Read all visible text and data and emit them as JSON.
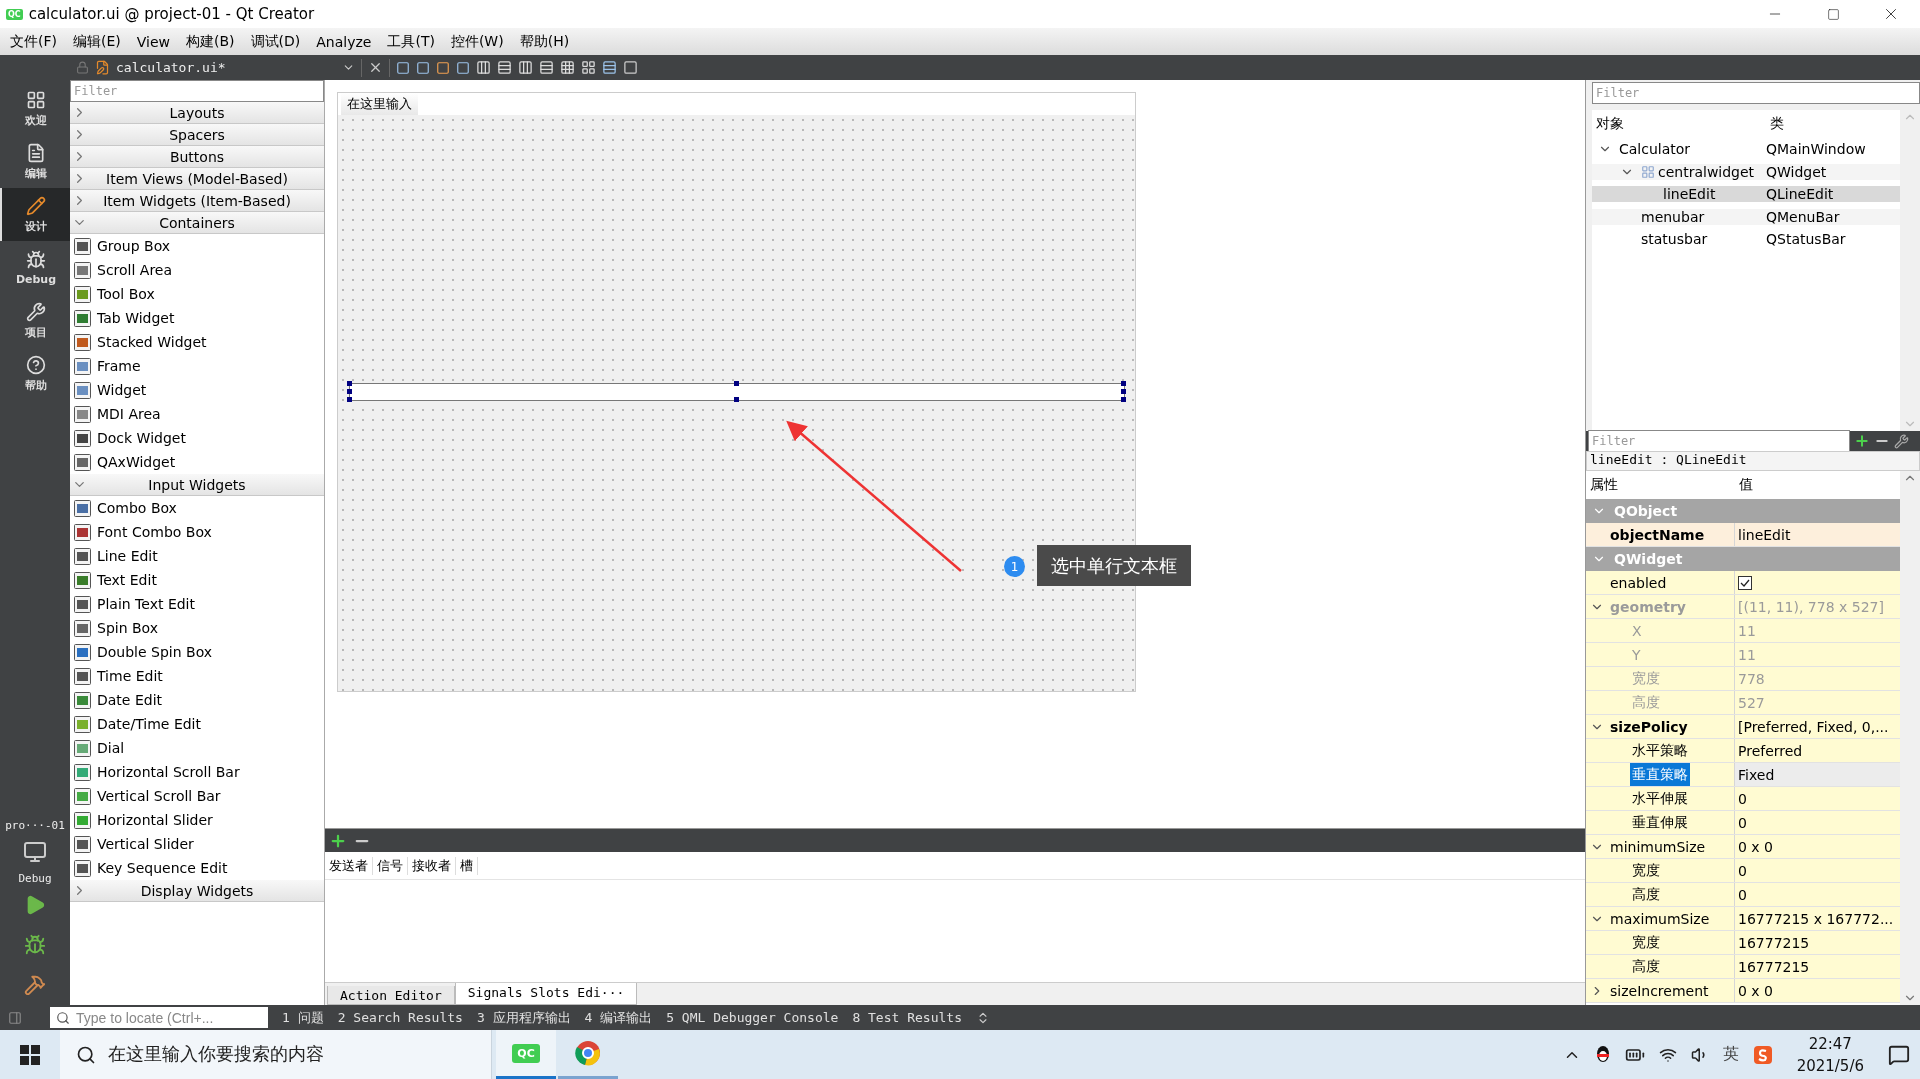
{
  "window": {
    "app_icon": "QC",
    "title": "calculator.ui @ project-01 - Qt Creator"
  },
  "menu": [
    {
      "label": "文件(F)"
    },
    {
      "label": "编辑(E)"
    },
    {
      "label": "View"
    },
    {
      "label": "构建(B)"
    },
    {
      "label": "调试(D)"
    },
    {
      "label": "Analyze"
    },
    {
      "label": "工具(T)"
    },
    {
      "label": "控件(W)"
    },
    {
      "label": "帮助(H)"
    }
  ],
  "editor_toolbar": {
    "file": "calculator.ui*"
  },
  "mode_bar": {
    "modes": [
      {
        "label": "欢迎",
        "selected": false
      },
      {
        "label": "编辑",
        "selected": false
      },
      {
        "label": "设计",
        "selected": true
      },
      {
        "label": "Debug",
        "selected": false
      },
      {
        "label": "项目",
        "selected": false
      },
      {
        "label": "帮助",
        "selected": false
      }
    ],
    "project": "pro···-01",
    "kit": "Debug"
  },
  "widget_box": {
    "filter_placeholder": "Filter",
    "categories": [
      {
        "label": "Layouts",
        "expanded": false
      },
      {
        "label": "Spacers",
        "expanded": false
      },
      {
        "label": "Buttons",
        "expanded": false
      },
      {
        "label": "Item Views (Model-Based)",
        "expanded": false
      },
      {
        "label": "Item Widgets (Item-Based)",
        "expanded": false
      },
      {
        "label": "Containers",
        "expanded": true,
        "items": [
          "Group Box",
          "Scroll Area",
          "Tool Box",
          "Tab Widget",
          "Stacked Widget",
          "Frame",
          "Widget",
          "MDI Area",
          "Dock Widget",
          "QAxWidget"
        ]
      },
      {
        "label": "Input Widgets",
        "expanded": true,
        "items": [
          "Combo Box",
          "Font Combo Box",
          "Line Edit",
          "Text Edit",
          "Plain Text Edit",
          "Spin Box",
          "Double Spin Box",
          "Time Edit",
          "Date Edit",
          "Date/Time Edit",
          "Dial",
          "Horizontal Scroll Bar",
          "Vertical Scroll Bar",
          "Horizontal Slider",
          "Vertical Slider",
          "Key Sequence Edit"
        ]
      },
      {
        "label": "Display Widgets",
        "expanded": false
      }
    ]
  },
  "form": {
    "menu_label": "在这里输入",
    "line_edit": {
      "selected": true
    }
  },
  "callout": {
    "number": "1",
    "text": "选中单行文本框"
  },
  "signal_editor": {
    "columns": [
      "发送者",
      "信号",
      "接收者",
      "槽"
    ],
    "tabs": [
      {
        "label": "Action Editor",
        "selected": false
      },
      {
        "label": "Signals  Slots Edi···",
        "selected": true
      }
    ]
  },
  "object_inspector": {
    "filter_placeholder": "Filter",
    "columns": [
      "对象",
      "类"
    ],
    "tree": [
      {
        "name": "Calculator",
        "class": "QMainWindow",
        "layout": false,
        "expanded": true,
        "selected": false,
        "children": [
          {
            "name": "centralwidget",
            "class": "QWidget",
            "layout": true,
            "expanded": true,
            "selected": false,
            "children": [
              {
                "name": "lineEdit",
                "class": "QLineEdit",
                "layout": false,
                "selected": true
              }
            ]
          },
          {
            "name": "menubar",
            "class": "QMenuBar",
            "layout": false,
            "selected": false
          },
          {
            "name": "statusbar",
            "class": "QStatusBar",
            "layout": false,
            "selected": false
          }
        ]
      }
    ]
  },
  "property_editor": {
    "filter_placeholder": "Filter",
    "object": "lineEdit : QLineEdit",
    "columns": [
      "属性",
      "值"
    ],
    "properties": [
      {
        "kind": "group",
        "name": "QObject",
        "color": "#fdefdc",
        "expanded": true,
        "children": [
          {
            "kind": "text",
            "name": "objectName",
            "value": "lineEdit",
            "bold": true,
            "selected": false
          }
        ]
      },
      {
        "kind": "group",
        "name": "QWidget",
        "color": "#fffbd2",
        "expanded": true,
        "children": [
          {
            "kind": "checkbox",
            "name": "enabled",
            "checked": true,
            "selected": false
          },
          {
            "kind": "text",
            "name": "geometry",
            "value": "[(11, 11), 778 x 527]",
            "bold": true,
            "disabled": true,
            "expanded": true,
            "selected": false,
            "children": [
              {
                "kind": "text",
                "name": "X",
                "value": "11",
                "disabled": true,
                "selected": false
              },
              {
                "kind": "text",
                "name": "Y",
                "value": "11",
                "disabled": true,
                "selected": false
              },
              {
                "kind": "text",
                "name": "宽度",
                "value": "778",
                "disabled": true,
                "selected": false
              },
              {
                "kind": "text",
                "name": "高度",
                "value": "527",
                "disabled": true,
                "selected": false
              }
            ]
          },
          {
            "kind": "text",
            "name": "sizePolicy",
            "value": "[Preferred, Fixed, 0,...",
            "bold": true,
            "expanded": true,
            "selected": false,
            "children": [
              {
                "kind": "text",
                "name": "水平策略",
                "value": "Preferred",
                "selected": false
              },
              {
                "kind": "text",
                "name": "垂直策略",
                "value": "Fixed",
                "selected": true
              },
              {
                "kind": "text",
                "name": "水平伸展",
                "value": "0",
                "selected": false
              },
              {
                "kind": "text",
                "name": "垂直伸展",
                "value": "0",
                "selected": false
              }
            ]
          },
          {
            "kind": "text",
            "name": "minimumSize",
            "value": "0 x 0",
            "expanded": true,
            "selected": false,
            "children": [
              {
                "kind": "text",
                "name": "宽度",
                "value": "0",
                "selected": false
              },
              {
                "kind": "text",
                "name": "高度",
                "value": "0",
                "selected": false
              }
            ]
          },
          {
            "kind": "text",
            "name": "maximumSize",
            "value": "16777215 x 167772...",
            "expanded": true,
            "selected": false,
            "children": [
              {
                "kind": "text",
                "name": "宽度",
                "value": "16777215",
                "selected": false
              },
              {
                "kind": "text",
                "name": "高度",
                "value": "16777215",
                "selected": false
              }
            ]
          },
          {
            "kind": "text",
            "name": "sizeIncrement",
            "value": "0 x 0",
            "expanded": false,
            "selected": false
          }
        ]
      }
    ]
  },
  "output_bar": {
    "locate_placeholder": "Type to locate (Ctrl+...",
    "panes": [
      "1 问题",
      "2 Search Results",
      "3 应用程序输出",
      "4 编译输出",
      "5 QML Debugger Console",
      "8 Test Results"
    ]
  },
  "taskbar": {
    "search_placeholder": "在这里输入你要搜索的内容",
    "apps": [
      {
        "kind": "qt",
        "label": "QC",
        "selected": true
      },
      {
        "kind": "browser",
        "selected": false
      }
    ],
    "ime": "英",
    "time": "22:47",
    "date": "2021/5/6"
  }
}
